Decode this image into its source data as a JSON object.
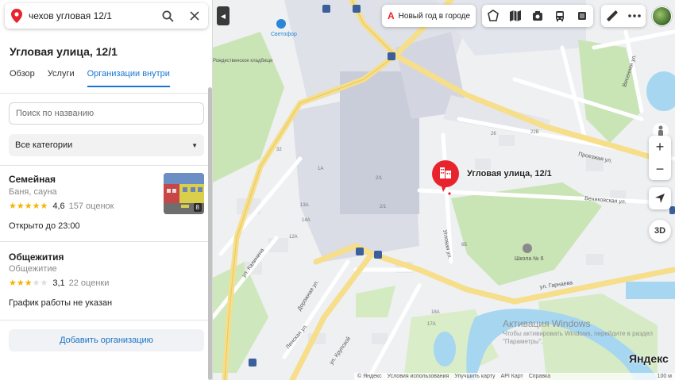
{
  "search": {
    "value": "чехов угловая 12/1"
  },
  "place": {
    "title": "Угловая улица, 12/1",
    "tabs": [
      "Обзор",
      "Услуги",
      "Организации внутри"
    ],
    "active_tab": 2
  },
  "filter": {
    "search_placeholder": "Поиск по названию",
    "category_select": "Все категории"
  },
  "orgs": [
    {
      "name": "Семейная",
      "category": "Баня, сауна",
      "rating": "4,6",
      "stars": 4.6,
      "reviews": "157 оценок",
      "hours": "Открыто до 23:00",
      "photo_count": "8"
    },
    {
      "name": "Общежития",
      "category": "Общежитие",
      "rating": "3,1",
      "stars": 3.1,
      "reviews": "22 оценки",
      "hours": "График работы не указан"
    }
  ],
  "add_org_label": "Добавить организацию",
  "map": {
    "promo_label": "Новый год в городе",
    "address_label": "Угловая улица, 12/1",
    "zoom_in": "+",
    "zoom_out": "−",
    "btn_3d": "3D",
    "streets": {
      "uglovaya": "Угловая ул.",
      "vennikovaya": "Веников­ская ул.",
      "garnaeva": "ул. Гарнаева",
      "dorozhnaya": "Дорожная ул.",
      "kalinina": "ул. Калинина",
      "lenskaya": "Ленская ул.",
      "krupskoy": "ул. Крупской",
      "proezzhaya": "Проезжая ул.",
      "vesennyaya": "Весенняя ул."
    },
    "poi": {
      "svetofor": "Светофор",
      "cemetery": "Рождественское кладбище",
      "school": "Школа № 6"
    },
    "house_numbers": [
      "2/1",
      "1А",
      "13А",
      "12А",
      "14А",
      "22В",
      "2/1",
      "6Б",
      "18А",
      "17А",
      "32",
      "26"
    ],
    "watermark_title": "Активация Windows",
    "watermark_text": "Чтобы активировать Windows, перейдите в раздел\n\"Параметры\".",
    "logo": "Яндекс",
    "footer": [
      "© Яндекс",
      "Условия использования",
      "Улучшить карту",
      "API Карт",
      "Справка"
    ],
    "scale": "100 м"
  },
  "colors": {
    "accent_blue": "#1976d2",
    "marker_red": "#e8232d",
    "star": "#f5b400",
    "road_yellow": "#f6de8a",
    "park_green": "#c9e4b5",
    "water": "#a7d6f0"
  }
}
